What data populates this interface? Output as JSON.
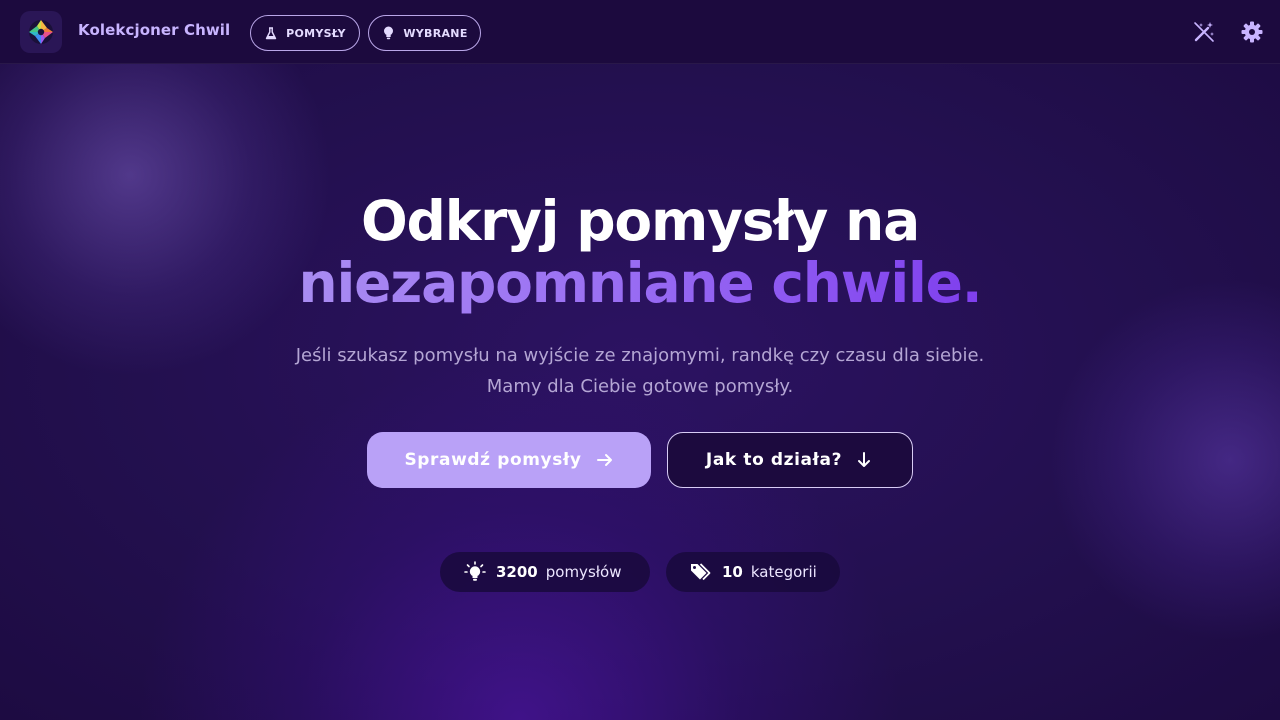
{
  "app": {
    "brand": "Kolekcjoner Chwil",
    "logo_icon": "camera-aperture-icon"
  },
  "nav": {
    "items": [
      {
        "label": "POMYSŁY",
        "icon": "flask-icon"
      },
      {
        "label": "WYBRANE",
        "icon": "lightbulb-icon"
      }
    ],
    "right_icons": [
      "magic-wand-icon",
      "gear-icon"
    ]
  },
  "hero": {
    "title_line1": "Odkryj pomysły na",
    "title_line2": "niezapomniane chwile.",
    "subtitle_line1": "Jeśli szukasz pomysłu na wyjście ze znajomymi, randkę czy czasu dla siebie.",
    "subtitle_line2": "Mamy dla Ciebie gotowe pomysły."
  },
  "actions": {
    "primary_label": "Sprawdź pomysły",
    "primary_icon": "arrow-right-icon",
    "secondary_label": "Jak to działa?",
    "secondary_icon": "arrow-down-icon"
  },
  "stats": [
    {
      "value": "3200",
      "label": "pomysłów",
      "icon": "lightbulb-icon"
    },
    {
      "value": "10",
      "label": "kategorii",
      "icon": "tags-icon"
    }
  ],
  "colors": {
    "background": "#1f0b47",
    "header": "#1c0a3e",
    "accent": "#b9a1f7",
    "gradient_start": "#a98cf2",
    "gradient_end": "#7f3fee",
    "brand_text": "#c8b4ff"
  }
}
